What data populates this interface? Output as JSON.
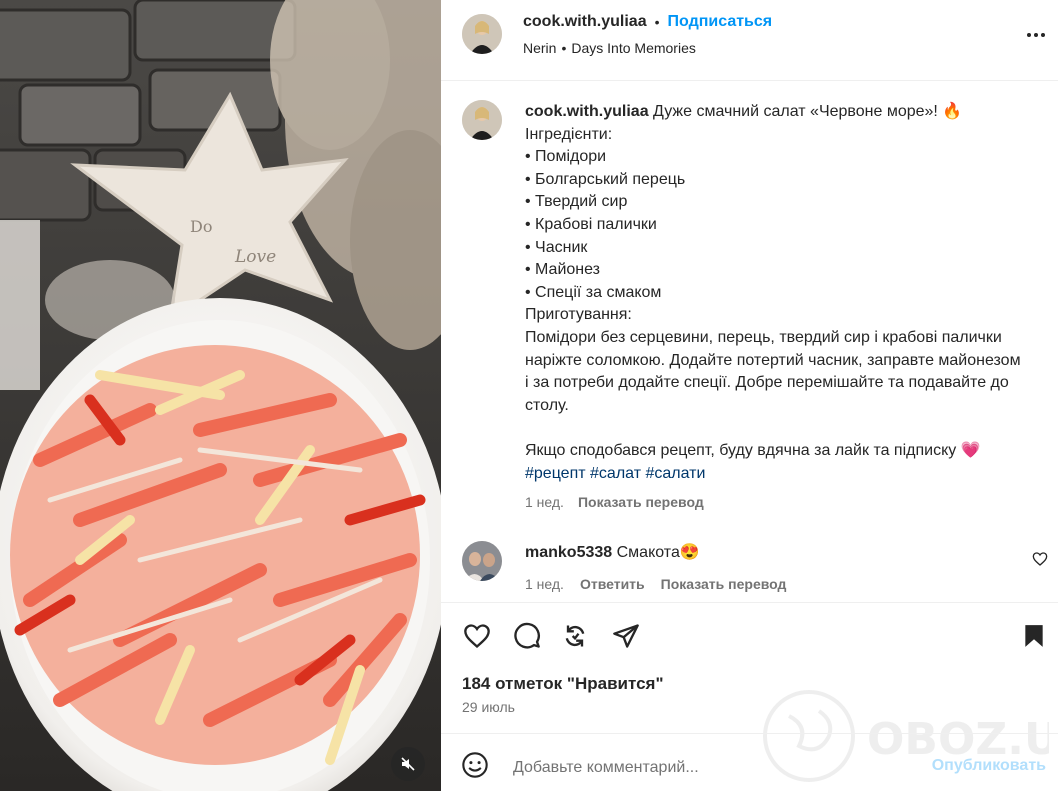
{
  "media": {
    "decor_text_1": "Do",
    "decor_text_2": "Love",
    "mute_icon": "speaker-muted-icon"
  },
  "header": {
    "username": "cook.with.yuliaa",
    "separator": "•",
    "follow_label": "Подписаться",
    "audio_artist": "Nerin",
    "audio_track": "Days Into Memories"
  },
  "caption": {
    "username": "cook.with.yuliaa",
    "title": "Дуже смачний салат «Червоне море»! 🔥",
    "ingredients_heading": "Інгредієнти:",
    "ingredients": [
      "• Помідори",
      "• Болгарський перець",
      "• Твердий сир",
      "• Крабові палички",
      "• Часник",
      "• Майонез",
      "• Спеції за смаком"
    ],
    "method_heading": "Приготування:",
    "method": "Помідори без серцевини, перець, твердий сир і крабові палички наріжте соломкою. Додайте потертий часник, заправте майонезом і за потреби додайте спеції. Добре перемішайте та подавайте до столу.",
    "closing": "Якщо сподобався рецепт, буду вдячна за лайк та підписку 💗",
    "hashtags": "#рецепт #салат #салати",
    "time": "1 нед.",
    "translate_label": "Показать перевод"
  },
  "comment": {
    "username": "manko5338",
    "text": "Смакота😍",
    "time": "1 нед.",
    "reply_label": "Ответить",
    "translate_label": "Показать перевод"
  },
  "actions": {
    "likes": "184 отметок \"Нравится\"",
    "date": "29 июль"
  },
  "add_comment": {
    "placeholder": "Добавьте комментарий...",
    "publish_label": "Опубликовать"
  },
  "watermark": "OBOZ.UA",
  "colors": {
    "accent": "#0095f6",
    "publish_disabled": "#b2dffc",
    "muted_text": "#737373",
    "hashtag": "#00376b"
  }
}
